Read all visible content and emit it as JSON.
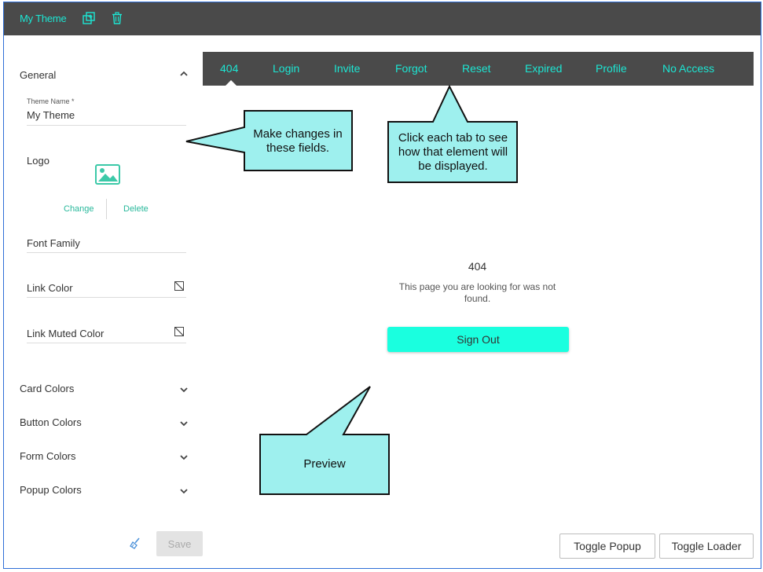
{
  "header": {
    "title": "My Theme",
    "icons": [
      "duplicate-icon",
      "trash-icon"
    ]
  },
  "sidebar": {
    "general_label": "General",
    "theme_name_label": "Theme Name *",
    "theme_name_value": "My Theme",
    "logo_label": "Logo",
    "logo_change": "Change",
    "logo_delete": "Delete",
    "font_family_label": "Font Family",
    "link_color_label": "Link Color",
    "link_muted_color_label": "Link Muted Color",
    "sections": [
      {
        "label": "Card Colors"
      },
      {
        "label": "Button Colors"
      },
      {
        "label": "Form Colors"
      },
      {
        "label": "Popup Colors"
      }
    ],
    "save_label": "Save"
  },
  "tabs": [
    {
      "label": "404"
    },
    {
      "label": "Login"
    },
    {
      "label": "Invite"
    },
    {
      "label": "Forgot"
    },
    {
      "label": "Reset"
    },
    {
      "label": "Expired"
    },
    {
      "label": "Profile"
    },
    {
      "label": "No Access"
    }
  ],
  "preview": {
    "code": "404",
    "message": "This page you are looking for was not found.",
    "signout_label": "Sign Out"
  },
  "footer": {
    "toggle_popup": "Toggle Popup",
    "toggle_loader": "Toggle Loader"
  },
  "callouts": {
    "fields": "Make changes in these fields.",
    "tabs": "Click each tab to see how that element will be displayed.",
    "preview": "Preview"
  },
  "colors": {
    "accent": "#1ce6d3",
    "header_bg": "#4a4a4a",
    "signout_bg": "#1affdf",
    "callout_bg": "#9ef0ee"
  }
}
